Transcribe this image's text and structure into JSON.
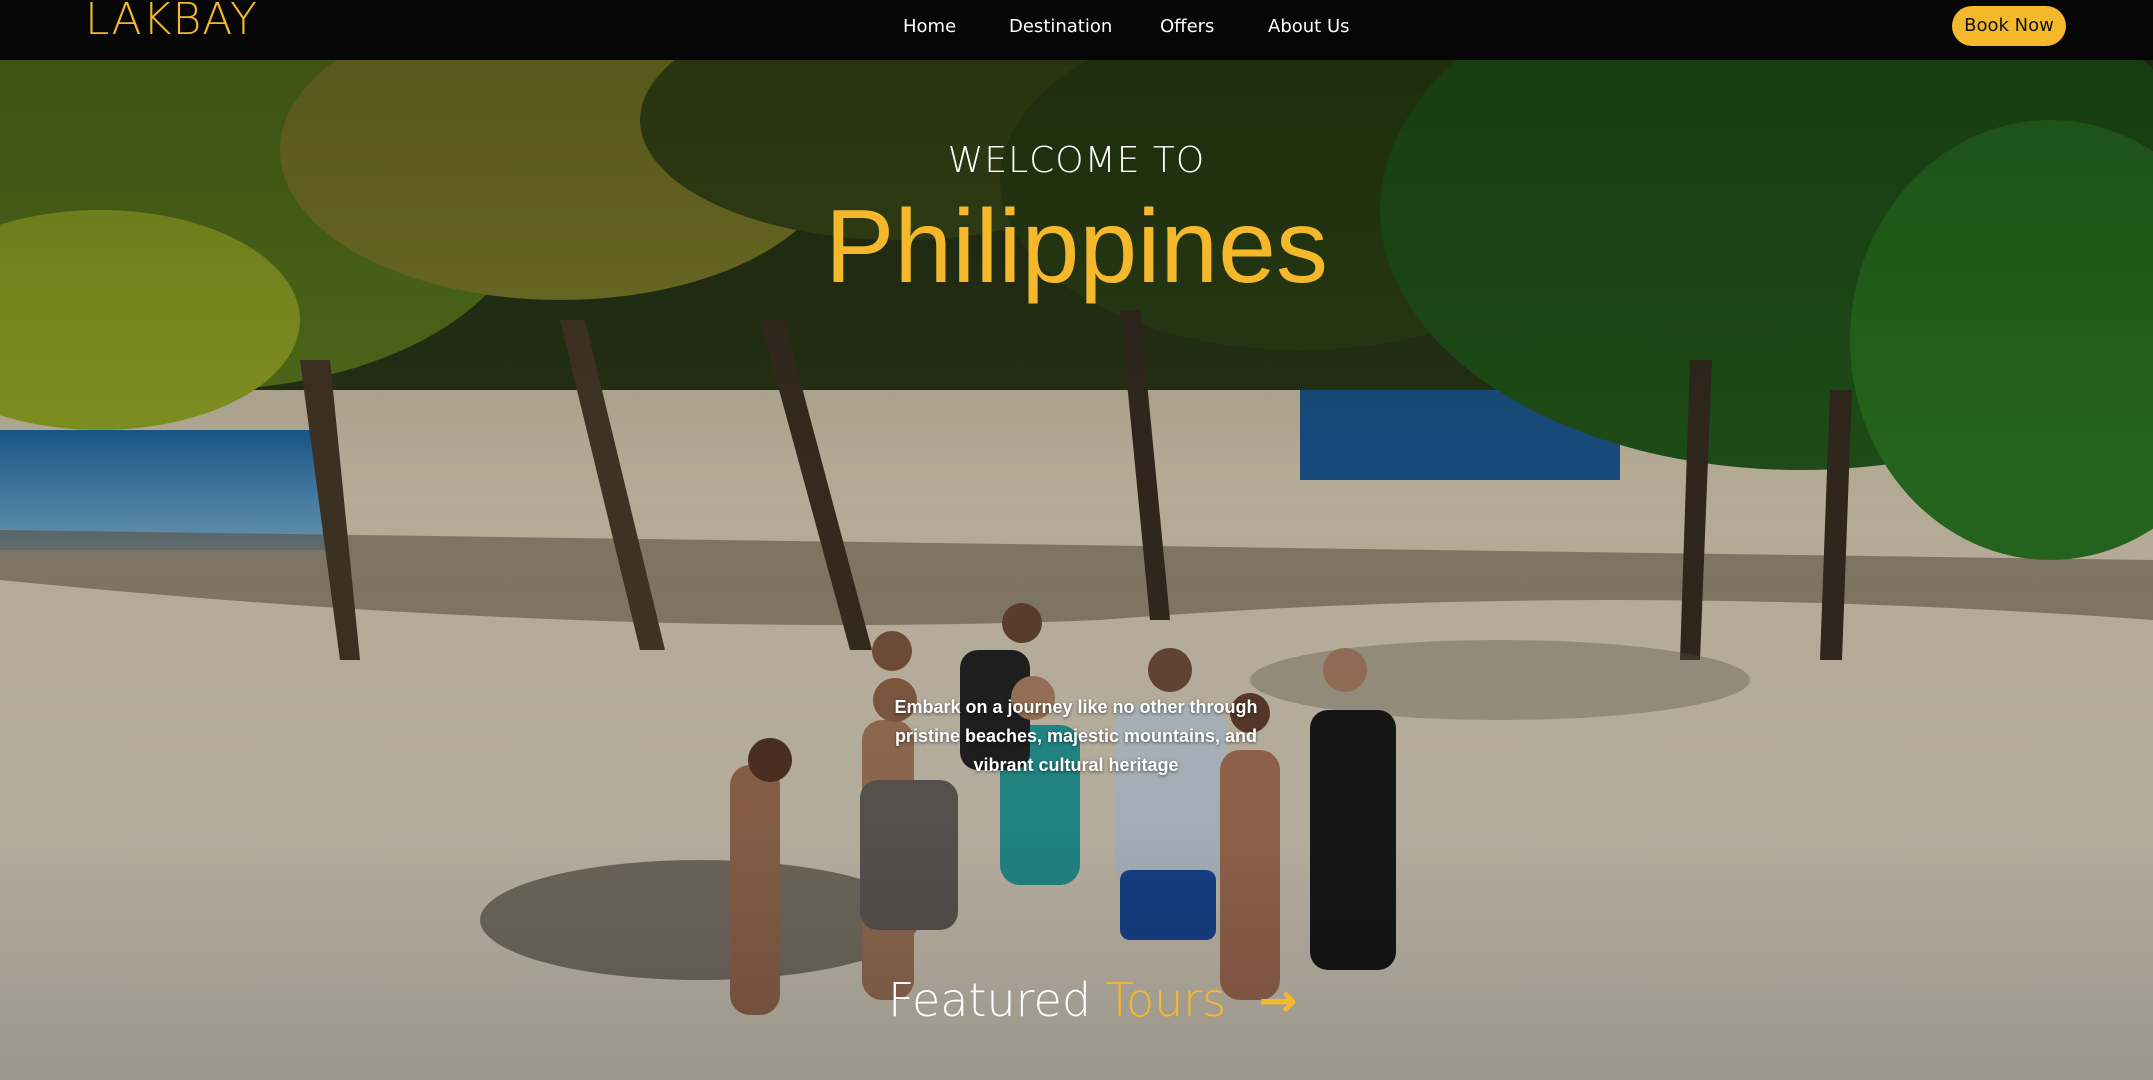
{
  "brand": {
    "logo": "LAKBAY",
    "accent": "#f5b82b"
  },
  "nav": {
    "items": [
      {
        "label": "Home"
      },
      {
        "label": "Destination"
      },
      {
        "label": "Offers"
      },
      {
        "label": "About Us"
      }
    ],
    "cta_label": "Book Now"
  },
  "hero": {
    "welcome": "WELCOME TO",
    "title": "Philippines",
    "tagline": "Embark on a journey like no other through pristine beaches, majestic mountains, and vibrant cultural heritage",
    "featured_word1": "Featured",
    "featured_word2": "Tours",
    "featured_arrow_icon": "arrow-right-icon"
  }
}
